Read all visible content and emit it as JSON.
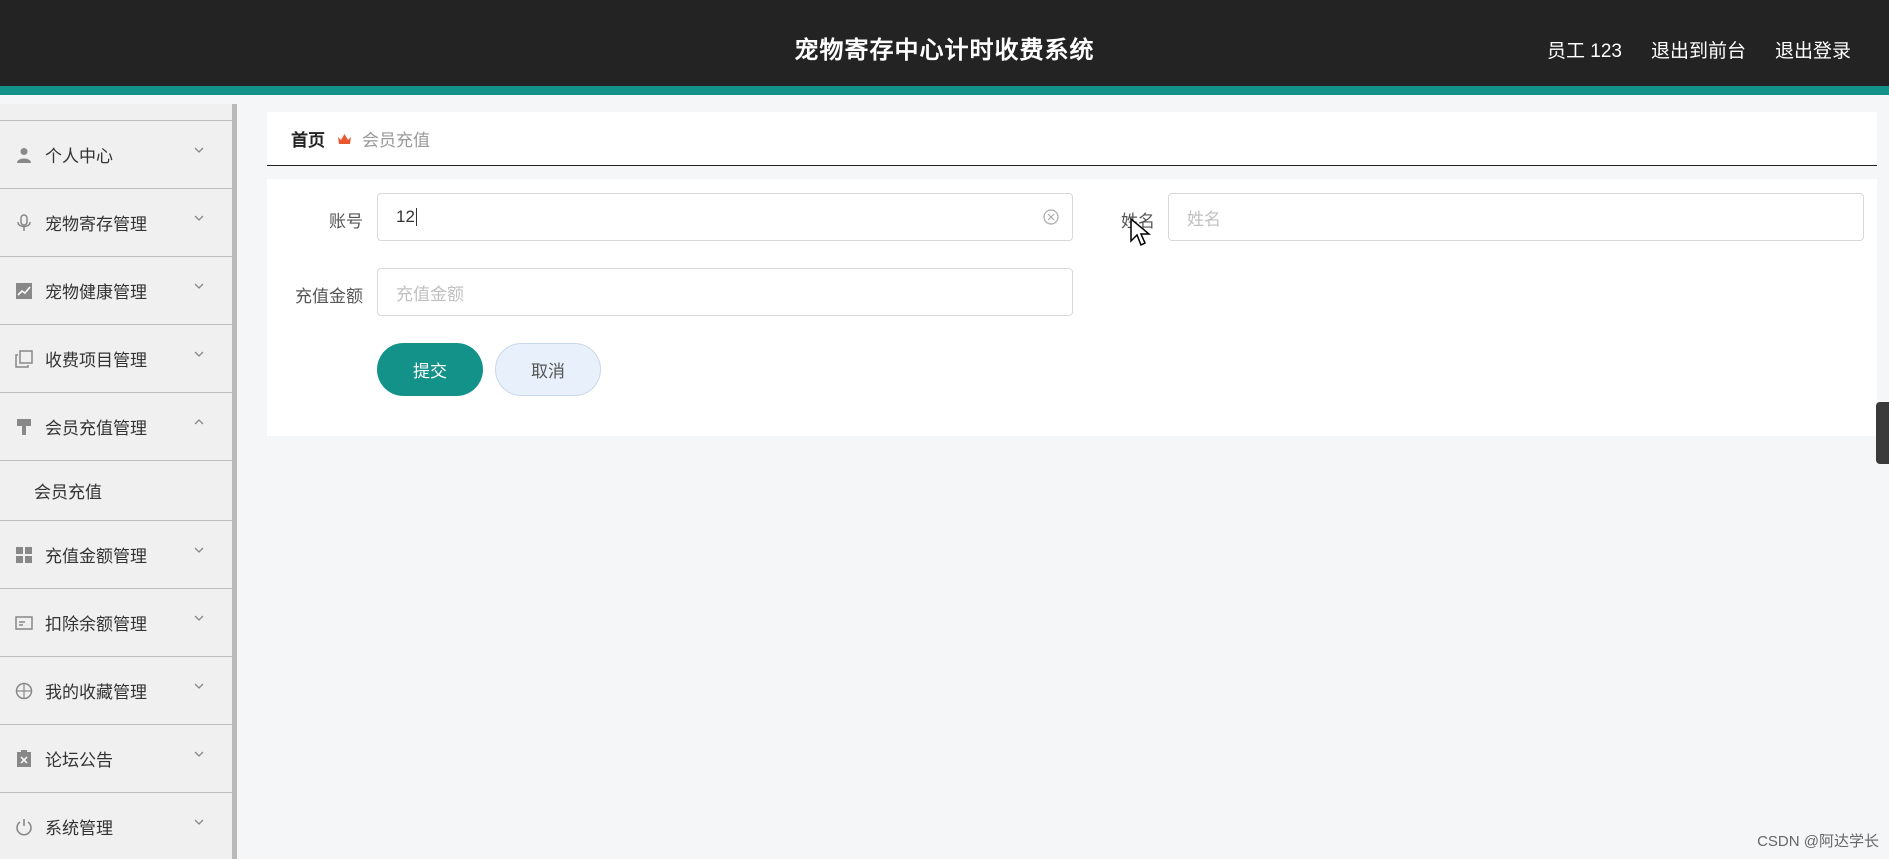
{
  "header": {
    "title": "宠物寄存中心计时收费系统",
    "user": "员工 123",
    "to_front": "退出到前台",
    "logout": "退出登录"
  },
  "sidebar": {
    "items": [
      {
        "label": "个人中心",
        "icon": "user-icon",
        "expanded": false
      },
      {
        "label": "宠物寄存管理",
        "icon": "microphone-icon",
        "expanded": false
      },
      {
        "label": "宠物健康管理",
        "icon": "trend-chart-icon",
        "expanded": false
      },
      {
        "label": "收费项目管理",
        "icon": "copy-icon",
        "expanded": false
      },
      {
        "label": "会员充值管理",
        "icon": "brush-icon",
        "expanded": true,
        "children": [
          "会员充值"
        ]
      },
      {
        "label": "充值金额管理",
        "icon": "grid-icon",
        "expanded": false
      },
      {
        "label": "扣除余额管理",
        "icon": "card-icon",
        "expanded": false
      },
      {
        "label": "我的收藏管理",
        "icon": "compass-icon",
        "expanded": false
      },
      {
        "label": "论坛公告",
        "icon": "delete-doc-icon",
        "expanded": false
      },
      {
        "label": "系统管理",
        "icon": "power-icon",
        "expanded": false
      }
    ]
  },
  "breadcrumb": {
    "home": "首页",
    "current": "会员充值"
  },
  "form": {
    "account_label": "账号",
    "account_value": "12",
    "name_label": "姓名",
    "name_placeholder": "姓名",
    "amount_label": "充值金额",
    "amount_placeholder": "充值金额",
    "submit": "提交",
    "cancel": "取消"
  },
  "watermark": "CSDN @阿达学长",
  "colors": {
    "accent": "#13928a",
    "header_bg": "#232323"
  }
}
